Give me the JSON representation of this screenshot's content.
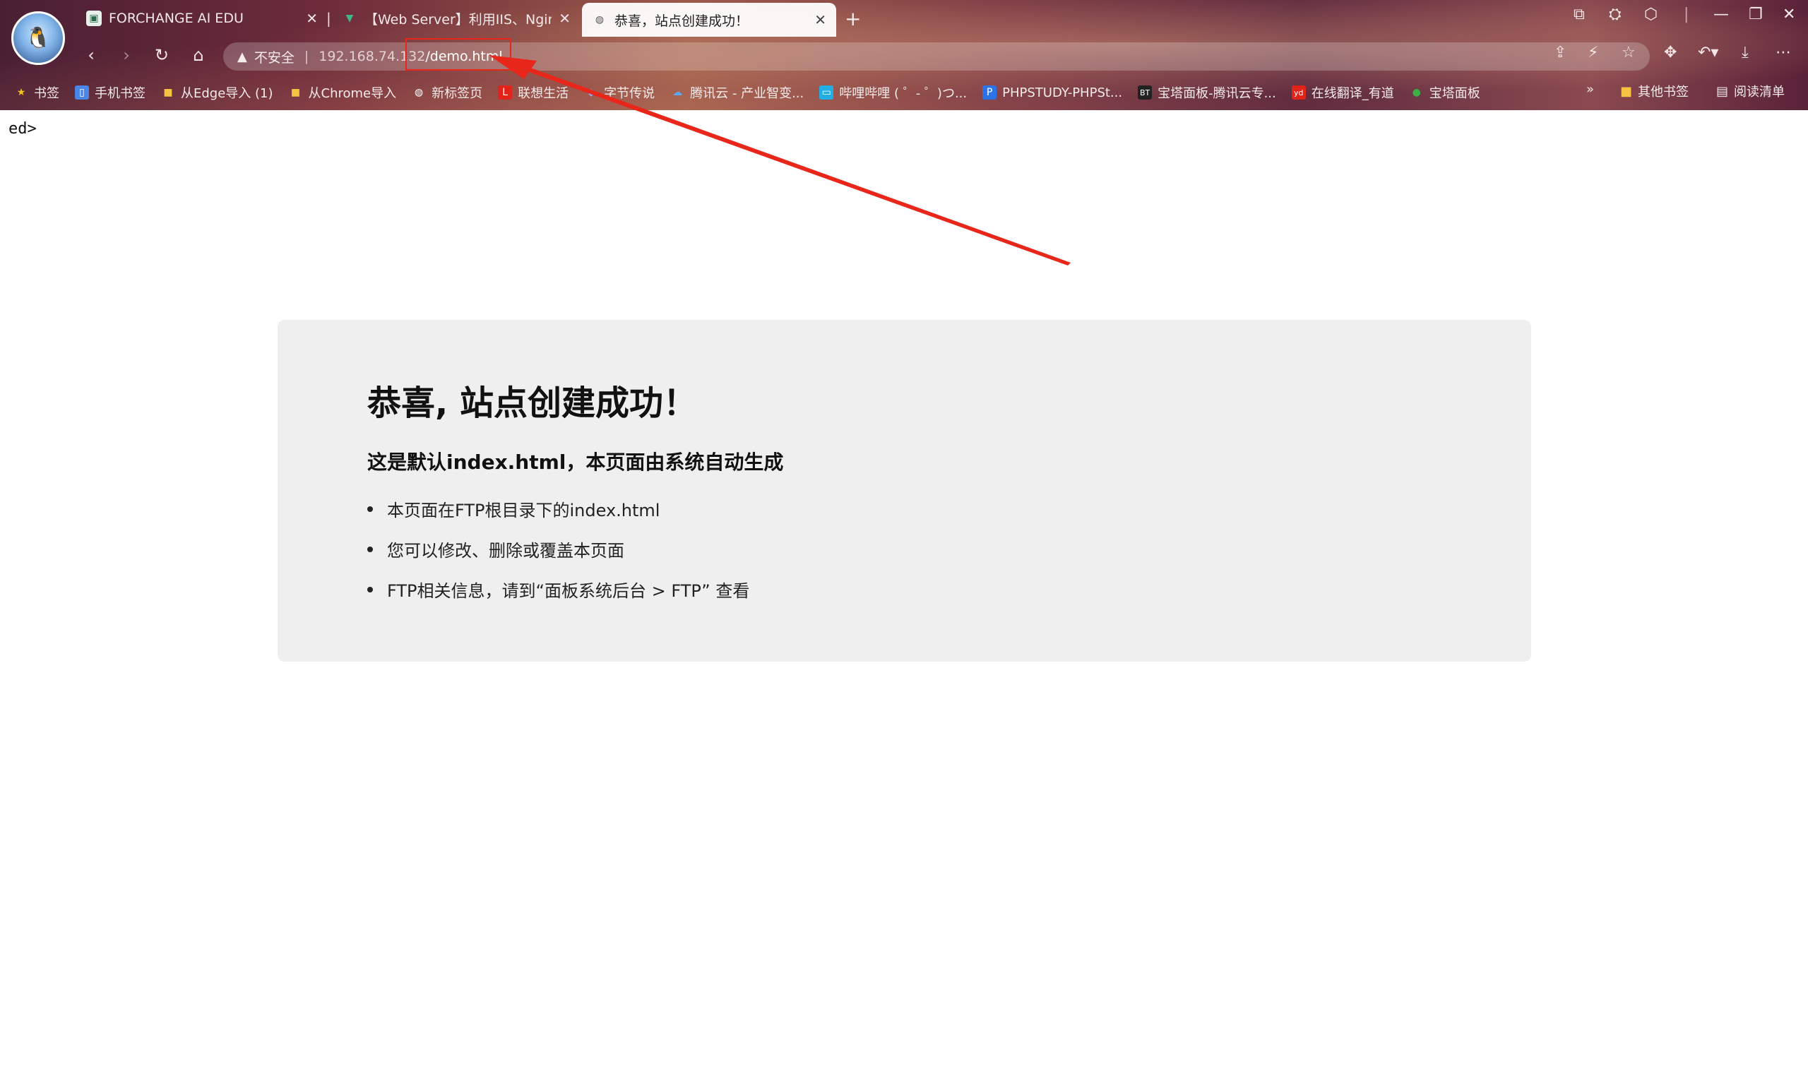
{
  "tabs": [
    {
      "title": "FORCHANGE AI EDU",
      "favicon": "fc-logo-icon",
      "active": false
    },
    {
      "title": "【Web Server】利用IIS、Nginx",
      "favicon": "vue-logo-icon",
      "active": false
    },
    {
      "title": "恭喜，站点创建成功！",
      "favicon": "globe-icon",
      "active": true
    }
  ],
  "toolbar": {
    "security_label": "不安全",
    "url_host": "192.168.74.132",
    "url_path": "/demo.html"
  },
  "bookmarks": {
    "items": [
      {
        "label": "书签",
        "icon": "star-icon"
      },
      {
        "label": "手机书签",
        "icon": "phone-icon"
      },
      {
        "label": "从Edge导入 (1)",
        "icon": "folder-icon"
      },
      {
        "label": "从Chrome导入",
        "icon": "folder-icon"
      },
      {
        "label": "新标签页",
        "icon": "edge-icon"
      },
      {
        "label": "联想生活",
        "icon": "lenovo-icon"
      },
      {
        "label": "字节传说",
        "icon": "bytes-icon"
      },
      {
        "label": "腾讯云 - 产业智变...",
        "icon": "cloud-icon"
      },
      {
        "label": "哔哩哔哩 ( ゜- ゜)つ...",
        "icon": "bilibili-icon"
      },
      {
        "label": "PHPSTUDY-PHPSt...",
        "icon": "p-icon"
      },
      {
        "label": "宝塔面板-腾讯云专...",
        "icon": "bt-icon"
      },
      {
        "label": "在线翻译_有道",
        "icon": "youdao-icon"
      },
      {
        "label": "宝塔面板",
        "icon": "leaf-icon"
      }
    ],
    "more": "»",
    "other": "其他书签",
    "reading_list": "阅读清单"
  },
  "page": {
    "stray_text": "ed>",
    "heading": "恭喜, 站点创建成功！",
    "subheading": "这是默认index.html，本页面由系统自动生成",
    "list": [
      "本页面在FTP根目录下的index.html",
      "您可以修改、删除或覆盖本页面",
      "FTP相关信息，请到“面板系统后台 > FTP” 查看"
    ]
  },
  "colors": {
    "annotation_red": "#e8261a",
    "card_bg": "#efefef"
  }
}
